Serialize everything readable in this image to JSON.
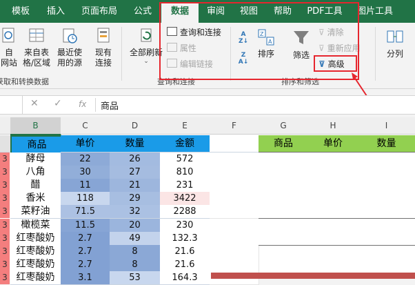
{
  "tabs": [
    {
      "label": "模板",
      "active": false
    },
    {
      "label": "插入",
      "active": false
    },
    {
      "label": "页面布局",
      "active": false
    },
    {
      "label": "公式",
      "active": false
    },
    {
      "label": "数据",
      "active": true
    },
    {
      "label": "审阅",
      "active": false
    },
    {
      "label": "视图",
      "active": false
    },
    {
      "label": "帮助",
      "active": false
    },
    {
      "label": "PDF工具",
      "active": false
    },
    {
      "label": "图片工具",
      "active": false
    }
  ],
  "ribbon": {
    "get_data": {
      "from_web": "自\n网站",
      "from_table": "来自表\n格/区域",
      "recent_sources": "最近使\n用的源",
      "existing_connections": "现有\n连接",
      "group_label": "获取和转换数据"
    },
    "queries": {
      "refresh_all": "全部刷新",
      "queries_connections": "查询和连接",
      "properties": "属性",
      "edit_links": "编辑链接",
      "group_label": "查询和连接"
    },
    "sort_filter": {
      "sort": "排序",
      "filter": "筛选",
      "clear": "清除",
      "reapply": "重新应用",
      "advanced": "高级",
      "group_label": "排序和筛选"
    },
    "tools": {
      "split": "分列"
    }
  },
  "formula_bar": {
    "value": "商品",
    "fx": "fx"
  },
  "colors": {
    "accent": "#217346",
    "highlight": "#e6262e",
    "header_blue": "#1a9be8",
    "header_green": "#92d050"
  },
  "columns": [
    "B",
    "C",
    "D",
    "E",
    "F",
    "G",
    "H",
    "I"
  ],
  "table": {
    "headers": [
      "商品",
      "单价",
      "数量",
      "金额"
    ],
    "rows": [
      [
        "3",
        "酵母",
        "22",
        "26",
        "572"
      ],
      [
        "3",
        "八角",
        "30",
        "27",
        "810"
      ],
      [
        "3",
        "醋",
        "11",
        "21",
        "231"
      ],
      [
        "3",
        "香米",
        "118",
        "29",
        "3422"
      ],
      [
        "3",
        "菜籽油",
        "71.5",
        "32",
        "2288"
      ],
      [
        "3",
        "橄榄菜",
        "11.5",
        "20",
        "230"
      ],
      [
        "3",
        "红枣酸奶",
        "2.7",
        "49",
        "132.3"
      ],
      [
        "3",
        "红枣酸奶",
        "2.7",
        "8",
        "21.6"
      ],
      [
        "3",
        "红枣酸奶",
        "2.7",
        "8",
        "21.6"
      ],
      [
        "3",
        "红枣酸奶",
        "3.1",
        "53",
        "164.3"
      ]
    ]
  },
  "criteria_headers": [
    "商品",
    "单价",
    "数量"
  ]
}
